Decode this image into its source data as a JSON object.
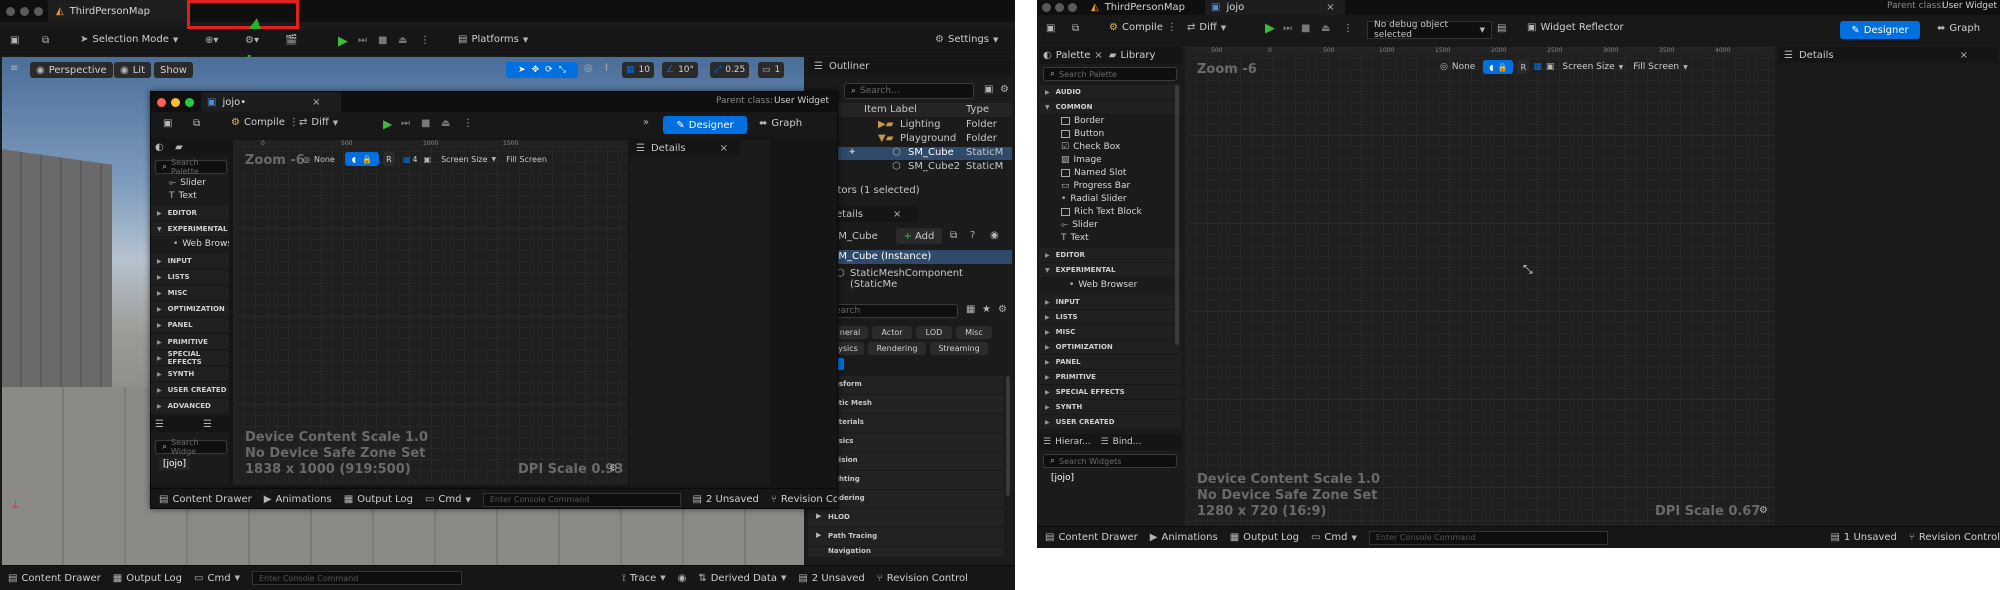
{
  "left": {
    "title_tab": "ThirdPersonMap",
    "main_toolbar": {
      "selection_mode": "Selection Mode",
      "platforms": "Platforms",
      "settings": "Settings"
    },
    "viewport": {
      "perspective": "Perspective",
      "lit": "Lit",
      "show": "Show",
      "grid_value": "10",
      "angle_value": "10°",
      "scale_value": "0.25",
      "camera_value": "1"
    },
    "outliner": {
      "title": "Outliner",
      "search_placeholder": "Search...",
      "col_label": "Item Label",
      "col_type": "Type",
      "rows": [
        {
          "label": "Lighting",
          "type": "Folder"
        },
        {
          "label": "Playground",
          "type": "Folder"
        },
        {
          "label": "SM_Cube",
          "type": "StaticM"
        },
        {
          "label": "SM_Cube2",
          "type": "StaticM"
        }
      ],
      "status": "ctors (1 selected)"
    },
    "details": {
      "title": "etails",
      "object": "SM_Cube",
      "add": "Add",
      "instance": "SM_Cube (Instance)",
      "component": "StaticMeshComponent (StaticMe",
      "search_placeholder": "earch",
      "filters": [
        "neral",
        "Actor",
        "LOD",
        "Misc",
        "ysics",
        "Rendering",
        "Streaming"
      ],
      "sections": [
        "nsform",
        "atic Mesh",
        "aterials",
        "ysics",
        "llision",
        "ghting",
        "ndering",
        "HLOD",
        "Path Tracing",
        "Navigation"
      ]
    },
    "bottom": {
      "content_drawer": "Content Drawer",
      "output_log": "Output Log",
      "cmd": "Cmd",
      "console_placeholder": "Enter Console Command",
      "trace": "Trace",
      "derived_data": "Derived Data",
      "unsaved": "2 Unsaved",
      "revision": "Revision Control"
    },
    "float_window": {
      "tab": "jojo•",
      "parent_class_label": "Parent class:",
      "parent_class": "User Widget",
      "compile": "Compile",
      "diff": "Diff",
      "designer": "Designer",
      "graph": "Graph",
      "palette_search": "Search Palette",
      "items_top": [
        "Slider",
        "Text"
      ],
      "categories": [
        "EDITOR",
        "EXPERIMENTAL",
        "INPUT",
        "LISTS",
        "MISC",
        "OPTIMIZATION",
        "PANEL",
        "PRIMITIVE",
        "SPECIAL EFFECTS",
        "SYNTH",
        "USER CREATED",
        "ADVANCED"
      ],
      "web_browser": "Web Browser",
      "hier_search": "Search Widge",
      "hier_root": "[jojo]",
      "zoom": "Zoom -6",
      "none": "None",
      "r": "R",
      "four": "4",
      "screen_size": "Screen Size",
      "fill_screen": "Fill Screen",
      "ruler": [
        "0",
        "500",
        "1000",
        "1500"
      ],
      "details": "Details",
      "overlay1": "Device Content Scale 1.0",
      "overlay2": "No Device Safe Zone Set",
      "overlay3": "1838 x 1000 (919:500)",
      "dpi": "DPI Scale 0.93",
      "bottom": {
        "content_drawer": "Content Drawer",
        "animations": "Animations",
        "output_log": "Output Log",
        "cmd": "Cmd",
        "console_placeholder": "Enter Console Command",
        "unsaved": "2 Unsaved",
        "revision": "Revision Co"
      }
    }
  },
  "right": {
    "tabs": [
      "ThirdPersonMap",
      "jojo"
    ],
    "parent_class_label": "Parent class:",
    "parent_class": "User Widget",
    "compile": "Compile",
    "diff": "Diff",
    "debug": "No debug object selected",
    "widget_reflector": "Widget Reflector",
    "designer": "Designer",
    "graph": "Graph",
    "palette_tab": "Palette",
    "library_tab": "Library",
    "palette_search": "Search Palette",
    "cat_audio": "AUDIO",
    "cat_common": "COMMON",
    "common_items": [
      "Border",
      "Button",
      "Check Box",
      "Image",
      "Named Slot",
      "Progress Bar",
      "Radial Slider",
      "Rich Text Block",
      "Slider",
      "Text"
    ],
    "categories_after": [
      "EDITOR",
      "EXPERIMENTAL"
    ],
    "web_browser": "Web Browser",
    "categories_more": [
      "INPUT",
      "LISTS",
      "MISC",
      "OPTIMIZATION",
      "PANEL",
      "PRIMITIVE",
      "SPECIAL EFFECTS",
      "SYNTH",
      "USER CREATED"
    ],
    "hier_tab": "Hierar...",
    "bind_tab": "Bind...",
    "hier_search": "Search Widgets",
    "hier_root": "[jojo]",
    "zoom": "Zoom -6",
    "none": "None",
    "screen_size": "Screen Size",
    "fill_screen": "Fill Screen",
    "ruler": [
      "500",
      "0",
      "500",
      "1000",
      "1500",
      "2000",
      "2500",
      "3000",
      "3500",
      "4000"
    ],
    "details": "Details",
    "overlay1": "Device Content Scale 1.0",
    "overlay2": "No Device Safe Zone Set",
    "overlay3": "1280 x 720 (16:9)",
    "dpi": "DPI Scale 0.67",
    "bottom": {
      "content_drawer": "Content Drawer",
      "animations": "Animations",
      "output_log": "Output Log",
      "cmd": "Cmd",
      "console_placeholder": "Enter Console Command",
      "unsaved": "1 Unsaved",
      "revision": "Revision Control"
    }
  },
  "colors": {
    "accent": "#0070e0",
    "highlight_box": "#e02020",
    "arrow": "#27b327",
    "play": "#3dbb3d",
    "bg_dark": "#1a1a1a",
    "titlebar": "#0f0f0f"
  }
}
